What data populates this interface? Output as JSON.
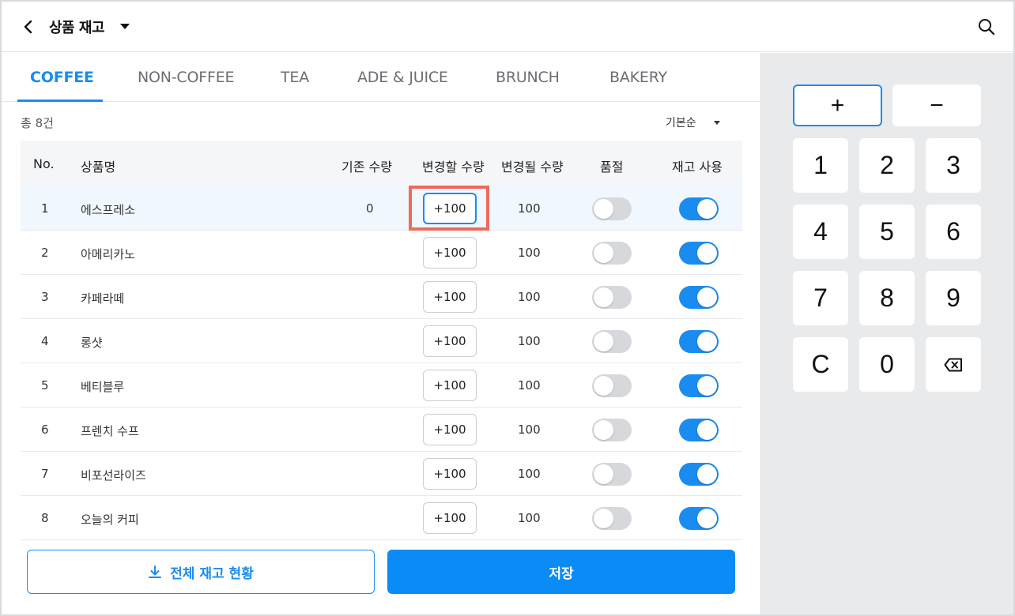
{
  "header": {
    "title": "상품 재고",
    "back_icon": "chevron-left-icon",
    "dropdown_icon": "caret-down-icon",
    "search_icon": "search-icon"
  },
  "tabs": [
    {
      "label": "COFFEE",
      "active": true
    },
    {
      "label": "NON-COFFEE",
      "active": false
    },
    {
      "label": "TEA",
      "active": false
    },
    {
      "label": "ADE & JUICE",
      "active": false
    },
    {
      "label": "BRUNCH",
      "active": false
    },
    {
      "label": "BAKERY",
      "active": false
    }
  ],
  "list": {
    "total": "총 8건",
    "sort_label": "기본순"
  },
  "table": {
    "headers": {
      "no": "No.",
      "name": "상품명",
      "current": "기존 수량",
      "change": "변경할 수량",
      "result": "변경될 수량",
      "soldout": "품절",
      "use_stock": "재고 사용"
    },
    "rows": [
      {
        "no": "1",
        "name": "에스프레소",
        "current": "0",
        "change": "+100",
        "result": "100",
        "soldout": false,
        "use_stock": true,
        "selected": true
      },
      {
        "no": "2",
        "name": "아메리카노",
        "current": "",
        "change": "+100",
        "result": "100",
        "soldout": false,
        "use_stock": true,
        "selected": false
      },
      {
        "no": "3",
        "name": "카페라떼",
        "current": "",
        "change": "+100",
        "result": "100",
        "soldout": false,
        "use_stock": true,
        "selected": false
      },
      {
        "no": "4",
        "name": "롱샷",
        "current": "",
        "change": "+100",
        "result": "100",
        "soldout": false,
        "use_stock": true,
        "selected": false
      },
      {
        "no": "5",
        "name": "베티블루",
        "current": "",
        "change": "+100",
        "result": "100",
        "soldout": false,
        "use_stock": true,
        "selected": false
      },
      {
        "no": "6",
        "name": "프렌치 수프",
        "current": "",
        "change": "+100",
        "result": "100",
        "soldout": false,
        "use_stock": true,
        "selected": false
      },
      {
        "no": "7",
        "name": "비포선라이즈",
        "current": "",
        "change": "+100",
        "result": "100",
        "soldout": false,
        "use_stock": true,
        "selected": false
      },
      {
        "no": "8",
        "name": "오늘의 커피",
        "current": "",
        "change": "+100",
        "result": "100",
        "soldout": false,
        "use_stock": true,
        "selected": false
      }
    ]
  },
  "actions": {
    "download_label": "전체 재고 현황",
    "download_icon": "download-icon",
    "save_label": "저장"
  },
  "keypad": {
    "plus": "+",
    "minus": "−",
    "keys": [
      "1",
      "2",
      "3",
      "4",
      "5",
      "6",
      "7",
      "8",
      "9",
      "C",
      "0"
    ],
    "backspace_icon": "backspace-icon"
  },
  "colors": {
    "accent": "#1a8cf0",
    "highlight": "#ee6a5a",
    "toggle_off": "#d6d8dc",
    "keypad_bg": "#e9eaec"
  }
}
